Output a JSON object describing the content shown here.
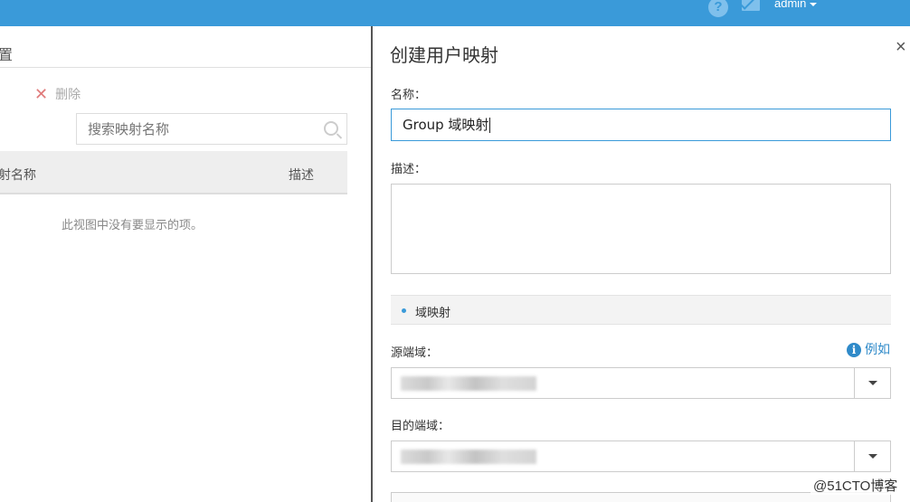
{
  "topbar": {
    "help_glyph": "?",
    "user": "admin"
  },
  "left": {
    "title": "置",
    "delete_label": "删除",
    "search_placeholder": "搜索映射名称",
    "columns": [
      "射名称",
      "描述"
    ],
    "empty_text": "此视图中没有要显示的项。"
  },
  "panel": {
    "title": "创建用户映射",
    "close_glyph": "×",
    "name_label": "名称：",
    "name_value": "Group 域映射",
    "desc_label": "描述：",
    "section_label": "域映射",
    "source_label": "源端域：",
    "example_label": "例如",
    "target_label": "目的端域："
  },
  "watermark": "@51CTO博客",
  "colors": {
    "accent": "#3a9ad9",
    "delete": "#e07a7a"
  }
}
